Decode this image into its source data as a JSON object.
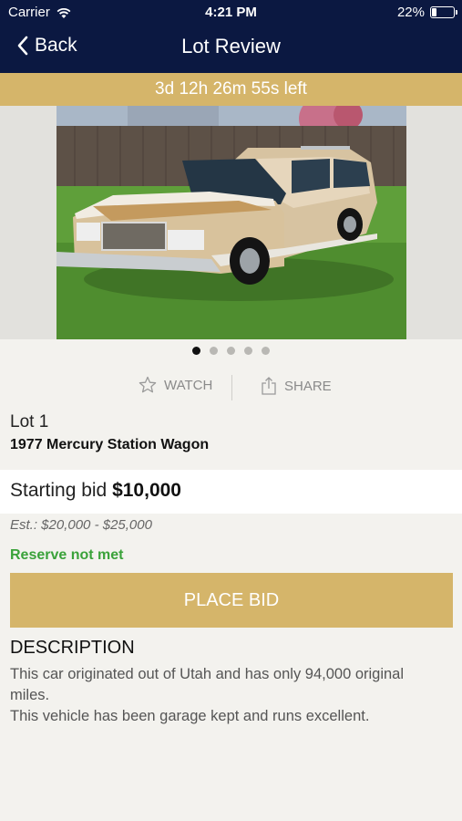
{
  "status_bar": {
    "carrier": "Carrier",
    "time": "4:21 PM",
    "battery_percent": "22%",
    "battery_level": 0.22
  },
  "nav": {
    "back_label": "Back",
    "title": "Lot Review"
  },
  "timer": {
    "text": "3d 12h 26m 55s left"
  },
  "gallery": {
    "image_count": 5,
    "active_index": 0
  },
  "actions": {
    "watch_label": "WATCH",
    "share_label": "SHARE"
  },
  "lot": {
    "number": "Lot 1",
    "title": "1977 Mercury Station Wagon",
    "starting_bid_label": "Starting bid",
    "starting_bid_amount": "$10,000",
    "estimate": "Est.: $20,000 - $25,000",
    "reserve_status": "Reserve not met"
  },
  "place_bid_label": "PLACE BID",
  "description": {
    "heading": "DESCRIPTION",
    "line1": "This car originated out of Utah and has only 94,000 original miles.",
    "line2": "This vehicle has been garage kept and runs excellent."
  },
  "colors": {
    "nav_background": "#0b1841",
    "accent_gold": "#d5b56a",
    "reserve_green": "#3aa23a"
  }
}
